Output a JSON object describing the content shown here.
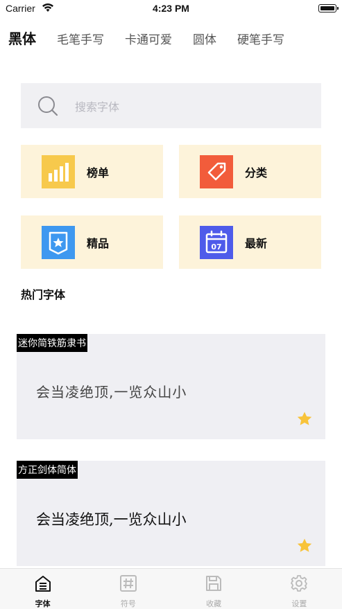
{
  "status_bar": {
    "carrier": "Carrier",
    "time": "4:23 PM"
  },
  "tabs": [
    {
      "label": "黑体",
      "active": true
    },
    {
      "label": "毛笔手写",
      "active": false
    },
    {
      "label": "卡通可爱",
      "active": false
    },
    {
      "label": "圆体",
      "active": false
    },
    {
      "label": "硬笔手写",
      "active": false
    }
  ],
  "search": {
    "placeholder": "搜索字体",
    "icon": "search-icon"
  },
  "categories": [
    {
      "label": "榜单",
      "icon": "bar-chart-icon",
      "color": "#f7c94c"
    },
    {
      "label": "分类",
      "icon": "tag-icon",
      "color": "#f25c3b"
    },
    {
      "label": "精品",
      "icon": "badge-star-icon",
      "color": "#3e98f0"
    },
    {
      "label": "最新",
      "icon": "calendar-icon",
      "color": "#4e5bea",
      "icon_text": "07"
    }
  ],
  "hot_fonts": {
    "title": "热门字体",
    "items": [
      {
        "name": "迷你简铁筋隶书",
        "sample": "会当凌绝顶,一览众山小",
        "favorited": true
      },
      {
        "name": "方正剑体简体",
        "sample": "会当凌绝顶,一览众山小",
        "favorited": true
      }
    ]
  },
  "tabbar": {
    "items": [
      {
        "label": "字体",
        "icon": "font-home-icon",
        "active": true
      },
      {
        "label": "符号",
        "icon": "hash-icon",
        "active": false
      },
      {
        "label": "收藏",
        "icon": "save-icon",
        "active": false
      },
      {
        "label": "设置",
        "icon": "gear-icon",
        "active": false
      }
    ]
  },
  "colors": {
    "accent": "#111111",
    "card_bg": "#fdf3da",
    "star": "#f8c33a",
    "search_bg": "#f0f0f3"
  }
}
